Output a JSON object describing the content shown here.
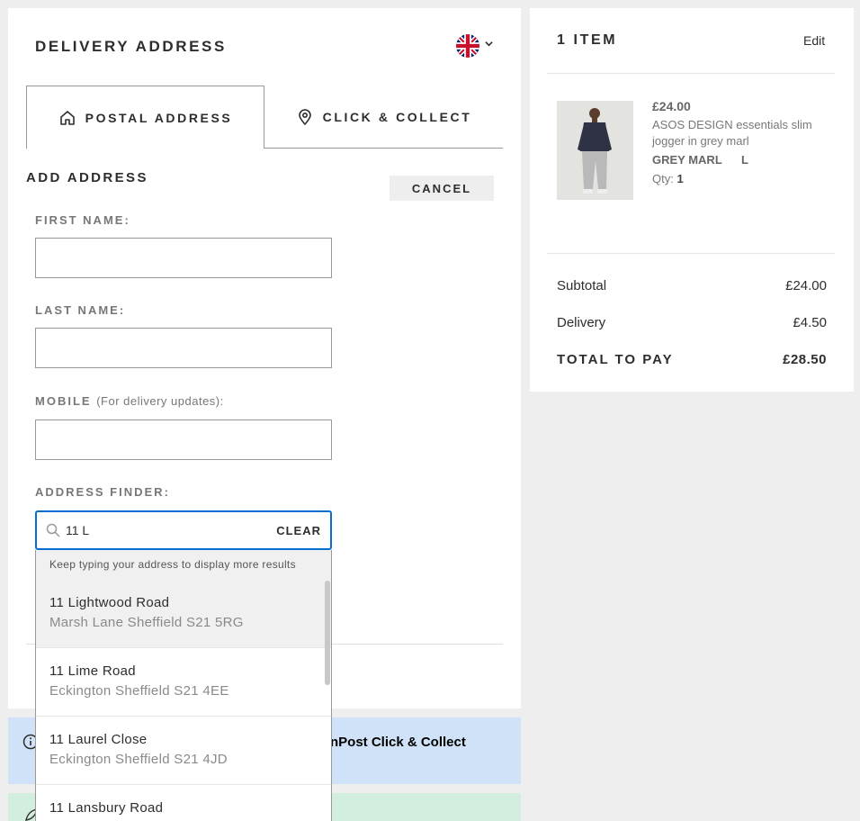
{
  "delivery": {
    "title": "DELIVERY ADDRESS",
    "flag_icon": "uk-flag-icon",
    "tabs": [
      {
        "label": "POSTAL ADDRESS",
        "icon": "home-icon",
        "active": true
      },
      {
        "label": "CLICK & COLLECT",
        "icon": "location-pin-icon",
        "active": false
      }
    ],
    "add_address_title": "ADD ADDRESS",
    "cancel_label": "CANCEL",
    "first_name_label": "FIRST NAME:",
    "last_name_label": "LAST NAME:",
    "mobile_label": "MOBILE",
    "mobile_hint": "(For delivery updates):",
    "first_name_value": "",
    "last_name_value": "",
    "mobile_value": "",
    "finder_label": "ADDRESS FINDER:",
    "finder_value": "11 L",
    "clear_label": "CLEAR",
    "dropdown_hint": "Keep typing your address to display more results",
    "suggestions": [
      {
        "line1": "11 Lightwood Road",
        "line2": "Marsh Lane Sheffield S21 5RG"
      },
      {
        "line1": "11 Lime Road",
        "line2": "Eckington Sheffield S21 4EE"
      },
      {
        "line1": "11 Laurel Close",
        "line2": "Eckington Sheffield S21 4JD"
      },
      {
        "line1": "11 Lansbury Road",
        "line2": ""
      }
    ]
  },
  "info_bar": {
    "text": "nPost Click & Collect",
    "bg": "#cfe2f7"
  },
  "green_bar": {
    "bg": "#d2eedf"
  },
  "bag": {
    "title": "1 ITEM",
    "edit_label": "Edit",
    "item": {
      "price": "£24.00",
      "name": "ASOS DESIGN essentials slim jogger in grey marl",
      "colour": "GREY MARL",
      "size": "L",
      "qty_label": "Qty:",
      "qty": "1"
    },
    "summary": {
      "subtotal_label": "Subtotal",
      "subtotal": "£24.00",
      "delivery_label": "Delivery",
      "delivery": "£4.50",
      "total_label": "TOTAL TO PAY",
      "total": "£28.50"
    }
  },
  "colors": {
    "accent": "#0770cf",
    "background": "#eeeeee"
  }
}
